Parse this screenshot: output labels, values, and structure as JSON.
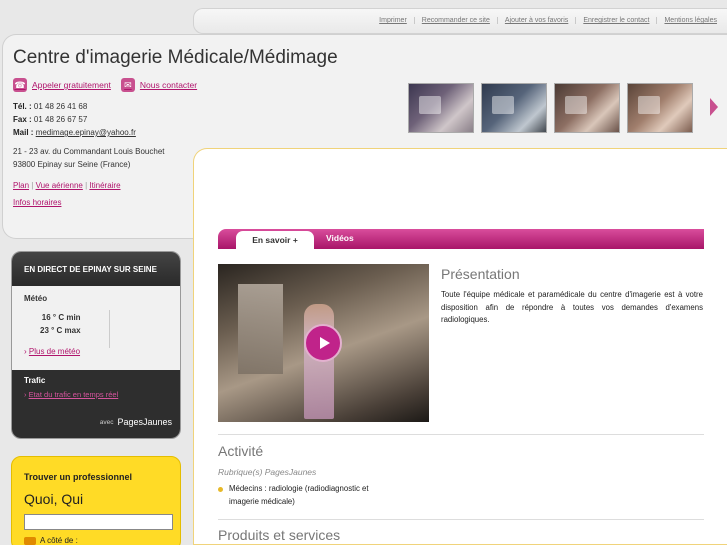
{
  "topbar": {
    "links": [
      "Imprimer",
      "Recommander ce site",
      "Ajouter à vos favoris",
      "Enregistrer le contact",
      "Mentions légales"
    ]
  },
  "header": {
    "title": "Centre d'imagerie Médicale/Médimage",
    "call_label": "Appeler gratuitement",
    "contact_label": "Nous contacter",
    "tel_label": "Tél. :",
    "tel": "01 48 26 41 68",
    "fax_label": "Fax :",
    "fax": "01 48 26 67 57",
    "mail_label": "Mail :",
    "mail": "medimage.epinay@yahoo.fr",
    "address_line1": "21 - 23 av. du Commandant Louis Bouchet",
    "address_line2": "93800 Epinay sur Seine (France)",
    "nav": [
      "Plan",
      "Vue aérienne",
      "Itinéraire"
    ],
    "nav_sep": "|",
    "horaires": "Infos horaires"
  },
  "tabs": {
    "active": "En savoir +",
    "videos": "Vidéos"
  },
  "presentation": {
    "title": "Présentation",
    "text": "Toute l'équipe médicale et paramédicale du centre d'imagerie est à votre disposition afin de répondre à toutes vos demandes d'examens radiologiques."
  },
  "activite": {
    "title": "Activité",
    "rubrique": "Rubrique(s) PagesJaunes",
    "item": "Médecins : radiologie (radiodiagnostic et imagerie médicale)"
  },
  "produits": {
    "title": "Produits et services"
  },
  "direct": {
    "heading": "EN DIRECT DE EPINAY SUR SEINE",
    "meteo_label": "Météo",
    "temp_min": "16 ° C min",
    "temp_max": "23 ° C max",
    "plus_meteo": "Plus de météo",
    "trafic_label": "Trafic",
    "trafic_link": "Etat du trafic en temps réel",
    "avec": "avec",
    "brand": "PagesJaunes"
  },
  "trouver": {
    "title": "Trouver un professionnel",
    "quoi": "Quoi, Qui",
    "acote": "A côté de :"
  },
  "colors": {
    "accent": "#b0146c",
    "tab_gradient_top": "#d94d9c",
    "yellow": "#ffdb26"
  }
}
